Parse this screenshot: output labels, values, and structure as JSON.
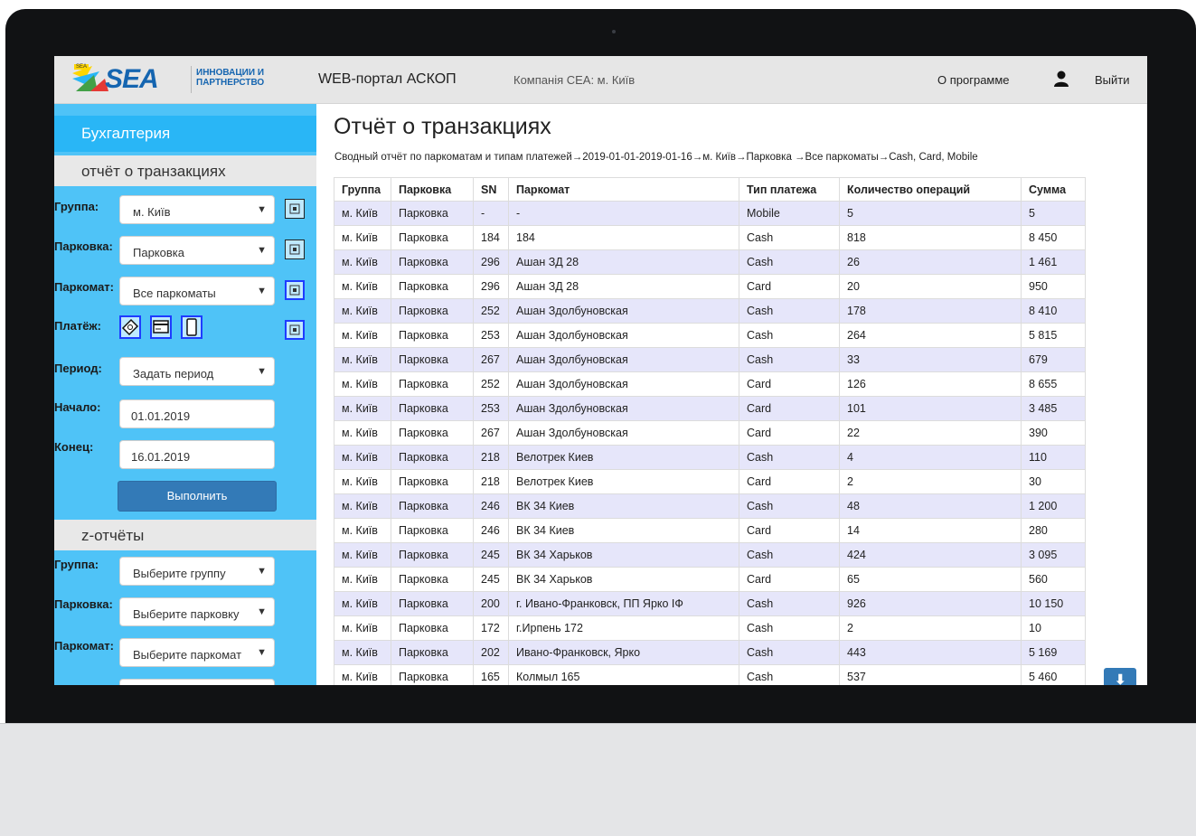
{
  "header": {
    "logo_text": "SEA",
    "logo_badge": "SEA",
    "logo_tagline_1": "ИННОВАЦИИ И",
    "logo_tagline_2": "ПАРТНЕРСТВО",
    "app_title": "WEB-портал АСКОП",
    "company": "Компанія СЕА: м. Київ",
    "about": "О программе",
    "logout": "Выйти"
  },
  "sidebar": {
    "title": "Бухгалтерия",
    "section_transactions": "отчёт о транзакциях",
    "labels": {
      "group": "Группа:",
      "parking": "Парковка:",
      "meter": "Паркомат:",
      "payment": "Платёж:",
      "period": "Период:",
      "start": "Начало:",
      "end": "Конец:"
    },
    "values": {
      "group": "м. Київ",
      "parking": "Парковка",
      "meter": "Все паркоматы",
      "period": "Задать период",
      "start": "01.01.2019",
      "end": "16.01.2019"
    },
    "run_button": "Выполнить",
    "section_z": "z-отчёты",
    "z_values": {
      "group": "Выберите группу",
      "parking": "Выберите парковку",
      "meter": "Выберите паркомат"
    },
    "arrow": "▼"
  },
  "main": {
    "title": "Отчёт о транзакциях",
    "breadcrumb": "Сводный отчёт по паркоматам и типам платежей→2019-01-01-2019-01-16→м. Київ→Парковка →Все паркоматы→Cash, Card, Mobile",
    "columns": [
      "Группа",
      "Парковка",
      "SN",
      "Паркомат",
      "Тип платежа",
      "Количество операций",
      "Сумма"
    ],
    "rows": [
      [
        "м. Київ",
        "Парковка",
        "-",
        "-",
        "Mobile",
        "5",
        "5"
      ],
      [
        "м. Київ",
        "Парковка",
        "184",
        "184",
        "Cash",
        "818",
        "8 450"
      ],
      [
        "м. Київ",
        "Парковка",
        "296",
        "Ашан ЗД 28",
        "Cash",
        "26",
        "1 461"
      ],
      [
        "м. Київ",
        "Парковка",
        "296",
        "Ашан ЗД 28",
        "Card",
        "20",
        "950"
      ],
      [
        "м. Київ",
        "Парковка",
        "252",
        "Ашан Здолбуновская",
        "Cash",
        "178",
        "8 410"
      ],
      [
        "м. Київ",
        "Парковка",
        "253",
        "Ашан Здолбуновская",
        "Cash",
        "264",
        "5 815"
      ],
      [
        "м. Київ",
        "Парковка",
        "267",
        "Ашан Здолбуновская",
        "Cash",
        "33",
        "679"
      ],
      [
        "м. Київ",
        "Парковка",
        "252",
        "Ашан Здолбуновская",
        "Card",
        "126",
        "8 655"
      ],
      [
        "м. Київ",
        "Парковка",
        "253",
        "Ашан Здолбуновская",
        "Card",
        "101",
        "3 485"
      ],
      [
        "м. Київ",
        "Парковка",
        "267",
        "Ашан Здолбуновская",
        "Card",
        "22",
        "390"
      ],
      [
        "м. Київ",
        "Парковка",
        "218",
        "Велотрек Киев",
        "Cash",
        "4",
        "110"
      ],
      [
        "м. Київ",
        "Парковка",
        "218",
        "Велотрек Киев",
        "Card",
        "2",
        "30"
      ],
      [
        "м. Київ",
        "Парковка",
        "246",
        "ВК 34 Киев",
        "Cash",
        "48",
        "1 200"
      ],
      [
        "м. Київ",
        "Парковка",
        "246",
        "ВК 34 Киев",
        "Card",
        "14",
        "280"
      ],
      [
        "м. Київ",
        "Парковка",
        "245",
        "ВК 34 Харьков",
        "Cash",
        "424",
        "3 095"
      ],
      [
        "м. Київ",
        "Парковка",
        "245",
        "ВК 34 Харьков",
        "Card",
        "65",
        "560"
      ],
      [
        "м. Київ",
        "Парковка",
        "200",
        "г. Ивано-Франковск, ПП Ярко ІФ",
        "Cash",
        "926",
        "10 150"
      ],
      [
        "м. Київ",
        "Парковка",
        "172",
        "г.Ирпень 172",
        "Cash",
        "2",
        "10"
      ],
      [
        "м. Київ",
        "Парковка",
        "202",
        "Ивано-Франковск, Ярко",
        "Cash",
        "443",
        "5 169"
      ],
      [
        "м. Київ",
        "Парковка",
        "165",
        "Колмыл 165",
        "Cash",
        "537",
        "5 460"
      ]
    ],
    "download_icon": "download-icon"
  },
  "colors": {
    "sidebar": "#4fc3f7",
    "sidebar_title": "#29b6f6",
    "button": "#337ab7",
    "row_stripe": "#e6e6fa",
    "brand": "#1565b0"
  }
}
